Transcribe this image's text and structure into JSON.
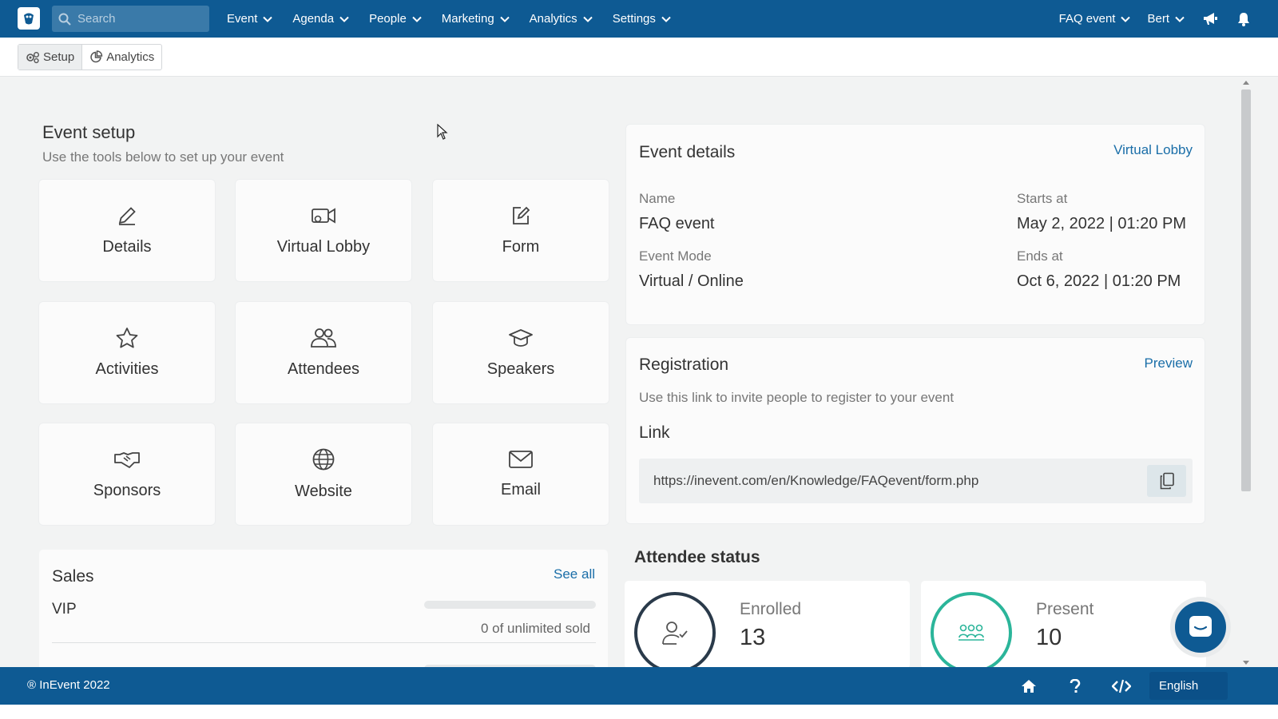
{
  "nav": {
    "search_placeholder": "Search",
    "items": [
      "Event",
      "Agenda",
      "People",
      "Marketing",
      "Analytics",
      "Settings"
    ],
    "event_selector": "FAQ event",
    "user": "Bert"
  },
  "subnav": {
    "setup": "Setup",
    "analytics": "Analytics"
  },
  "setup": {
    "title": "Event setup",
    "subtitle": "Use the tools below to set up your event",
    "tiles": [
      "Details",
      "Virtual Lobby",
      "Form",
      "Activities",
      "Attendees",
      "Speakers",
      "Sponsors",
      "Website",
      "Email"
    ]
  },
  "sales": {
    "title": "Sales",
    "see_all": "See all",
    "ticket": "VIP",
    "sold_text": "0 of unlimited sold",
    "sold_fraction": 0
  },
  "details": {
    "title": "Event details",
    "link": "Virtual Lobby",
    "name_label": "Name",
    "name": "FAQ event",
    "mode_label": "Event Mode",
    "mode": "Virtual / Online",
    "starts_label": "Starts at",
    "starts": "May 2, 2022 | 01:20 PM",
    "ends_label": "Ends at",
    "ends": "Oct 6, 2022 | 01:20 PM"
  },
  "registration": {
    "title": "Registration",
    "preview": "Preview",
    "description": "Use this link to invite people to register to your event",
    "link_label": "Link",
    "url": "https://inevent.com/en/Knowledge/FAQevent/form.php"
  },
  "attendee_status": {
    "title": "Attendee status",
    "enrolled_label": "Enrolled",
    "enrolled": "13",
    "present_label": "Present",
    "present": "10"
  },
  "footer": {
    "copyright": "® InEvent 2022",
    "language": "English"
  },
  "colors": {
    "primary": "#0e5a93",
    "link": "#1a6ea8",
    "present_ring": "#2bb59a",
    "enrolled_ring": "#2a3a4a"
  }
}
